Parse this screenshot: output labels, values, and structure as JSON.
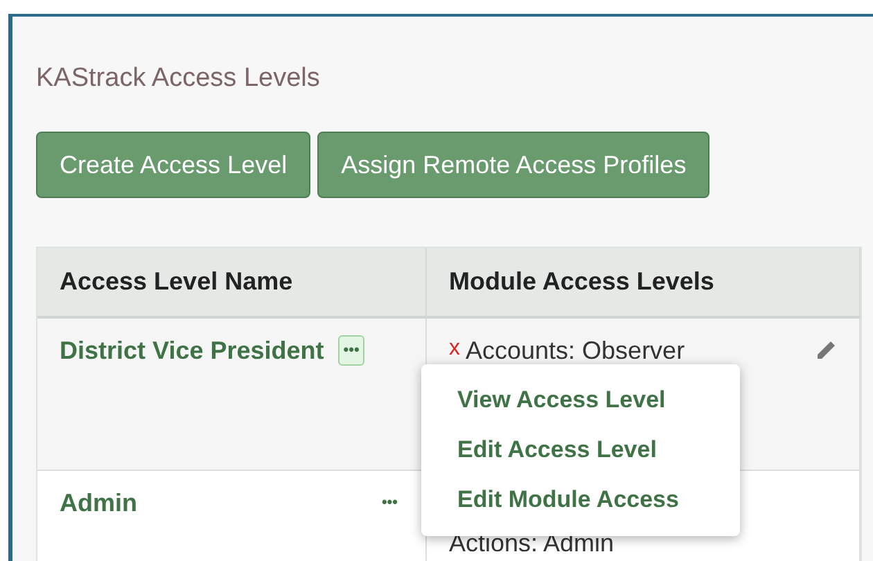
{
  "page": {
    "title": "KAStrack Access Levels"
  },
  "buttons": [
    "Create Access Level",
    "Assign Remote Access Profiles"
  ],
  "table": {
    "columns": [
      "Access Level Name",
      "Module Access Levels"
    ],
    "rows": [
      {
        "name": "District Vice President",
        "actions_icon": "•••",
        "menu_open": true,
        "editable": true,
        "modules": [
          {
            "mark": "x",
            "text": "Accounts: Observer"
          }
        ]
      },
      {
        "name": "Admin",
        "actions_icon": "•••",
        "menu_open": false,
        "editable": false,
        "modules": [
          {
            "text": "Actions: Admin"
          }
        ]
      }
    ]
  },
  "menu": {
    "items": [
      "View Access Level",
      "Edit Access Level",
      "Edit Module Access"
    ]
  }
}
